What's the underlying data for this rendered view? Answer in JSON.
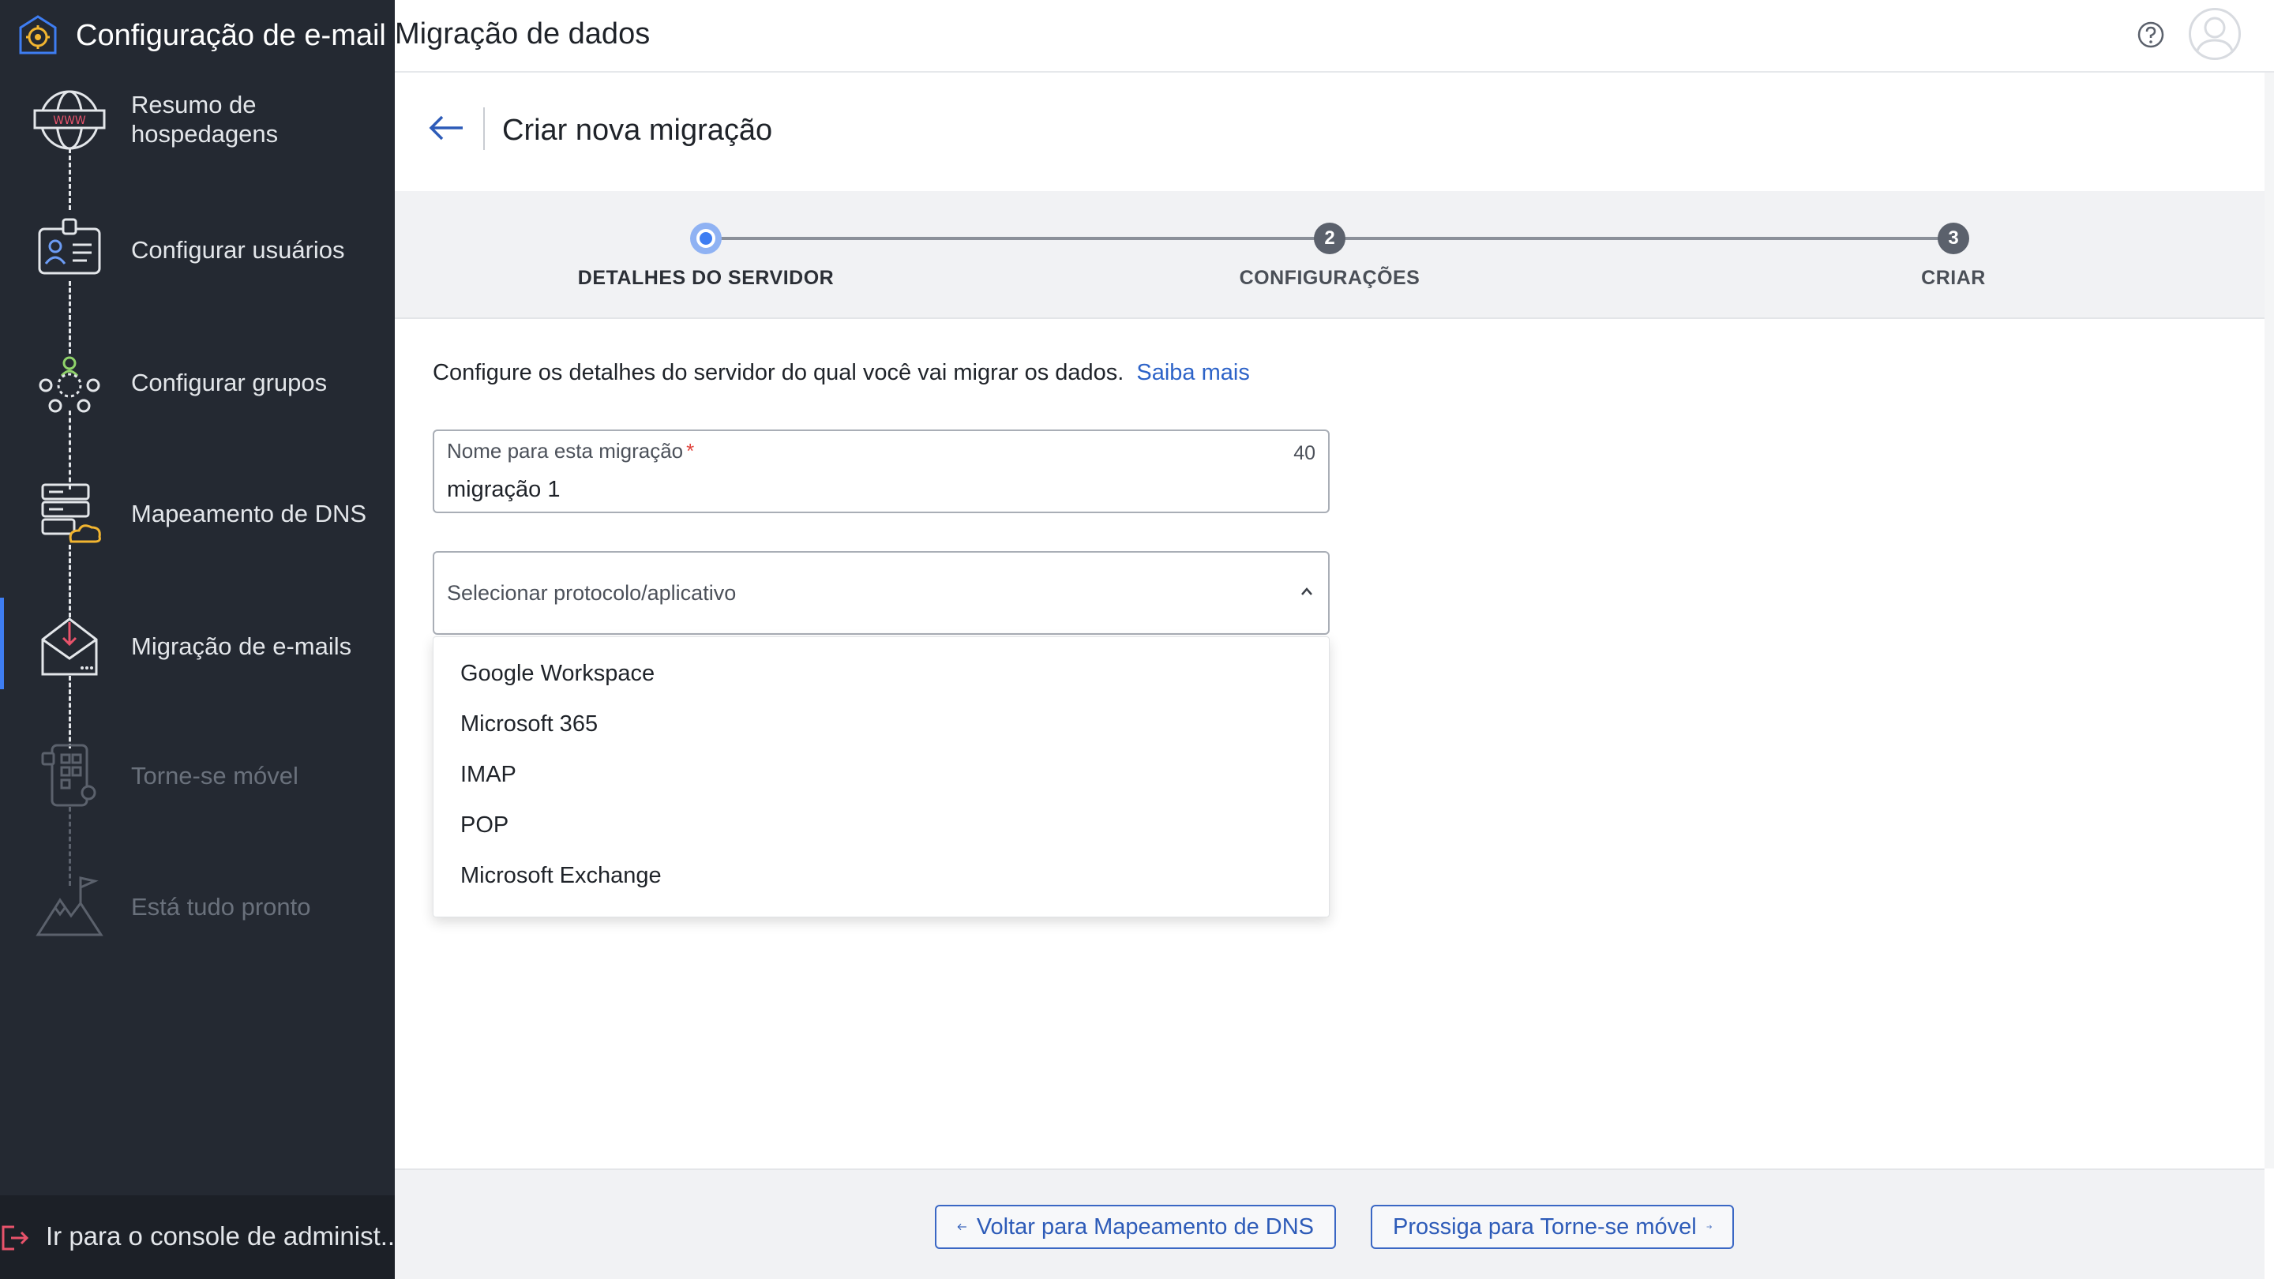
{
  "sidebar": {
    "brand_title": "Configuração de e-mail",
    "steps": [
      {
        "label": "Resumo de hospedagens",
        "icon": "globe-www-icon",
        "state": "done"
      },
      {
        "label": "Configurar usuários",
        "icon": "user-id-card-icon",
        "state": "done"
      },
      {
        "label": "Configurar grupos",
        "icon": "group-network-icon",
        "state": "done"
      },
      {
        "label": "Mapeamento de DNS",
        "icon": "dns-server-cloud-icon",
        "state": "done"
      },
      {
        "label": "Migração de e-mails",
        "icon": "email-inbox-download-icon",
        "state": "active"
      },
      {
        "label": "Torne-se móvel",
        "icon": "mobile-apps-icon",
        "state": "disabled"
      },
      {
        "label": "Está tudo pronto",
        "icon": "mountain-flag-icon",
        "state": "disabled"
      }
    ],
    "footer_label": "Ir para o console de administ..."
  },
  "topbar": {
    "title": "Migração de dados"
  },
  "page": {
    "title": "Criar nova migração"
  },
  "stepper": {
    "steps": [
      {
        "label": "DETALHES DO SERVIDOR",
        "number": "",
        "state": "current"
      },
      {
        "label": "CONFIGURAÇÕES",
        "number": "2",
        "state": "pending"
      },
      {
        "label": "CRIAR",
        "number": "3",
        "state": "pending"
      }
    ]
  },
  "form": {
    "intro": "Configure os detalhes do servidor do qual você vai migrar os dados.",
    "learn_more": "Saiba mais",
    "name_field": {
      "label": "Nome para esta migração",
      "required_mark": "*",
      "counter": "40",
      "value": "migração 1"
    },
    "protocol_select": {
      "placeholder": "Selecionar protocolo/aplicativo",
      "options": [
        "Google Workspace",
        "Microsoft 365",
        "IMAP",
        "POP",
        "Microsoft Exchange"
      ]
    }
  },
  "footer": {
    "back_label": "Voltar para Mapeamento de DNS",
    "next_label": "Prossiga para Torne-se móvel"
  },
  "colors": {
    "sidebar_bg": "#242932",
    "accent": "#3e7df2",
    "link": "#2d63c8",
    "required": "#e0433c"
  }
}
